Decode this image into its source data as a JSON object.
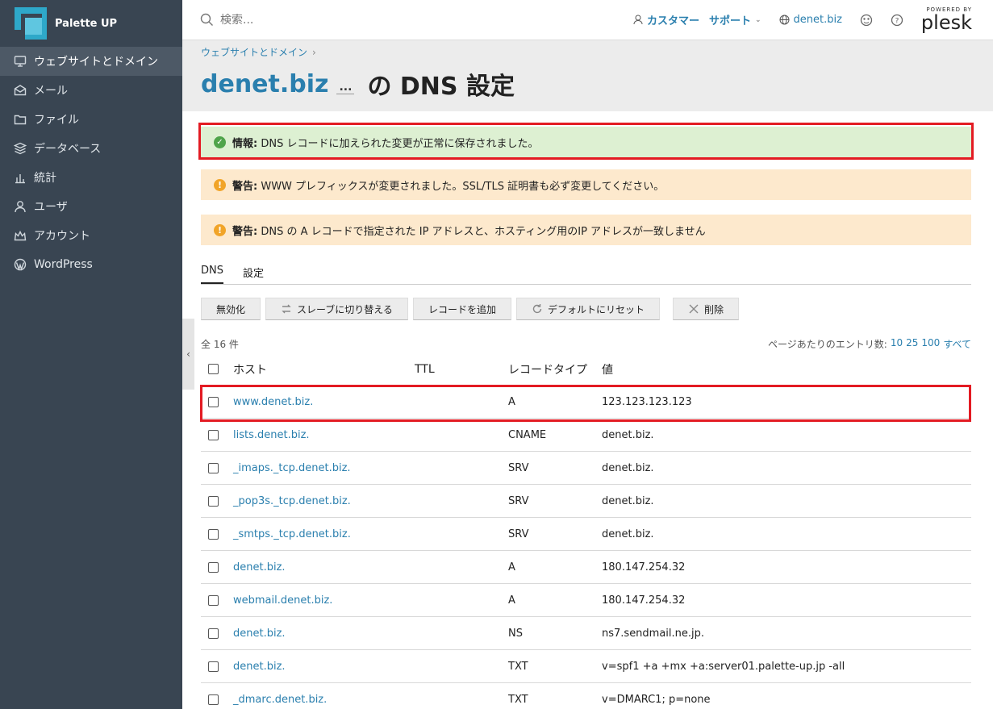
{
  "sidebar": {
    "brand": "Palette UP",
    "items": [
      {
        "label": "ウェブサイトとドメイン",
        "icon": "monitor-icon",
        "active": true
      },
      {
        "label": "メール",
        "icon": "mail-icon"
      },
      {
        "label": "ファイル",
        "icon": "folder-icon"
      },
      {
        "label": "データベース",
        "icon": "database-icon"
      },
      {
        "label": "統計",
        "icon": "bar-chart-icon"
      },
      {
        "label": "ユーザ",
        "icon": "user-icon"
      },
      {
        "label": "アカウント",
        "icon": "crown-icon"
      },
      {
        "label": "WordPress",
        "icon": "wordpress-icon"
      }
    ]
  },
  "header": {
    "search_placeholder": "検索...",
    "customer": "カスタマー",
    "support": "サポート",
    "domain": "denet.biz",
    "powered_by": "POWERED BY",
    "plesk": "plesk"
  },
  "breadcrumb": "ウェブサイトとドメイン",
  "title": {
    "domain": "denet.biz",
    "more": "...",
    "suffix": "の DNS 設定"
  },
  "banners": {
    "info": {
      "label": "情報:",
      "text": " DNS レコードに加えられた変更が正常に保存されました。"
    },
    "warn1": {
      "label": "警告:",
      "text": " WWW プレフィックスが変更されました。SSL/TLS 証明書も必ず変更してください。"
    },
    "warn2": {
      "label": "警告:",
      "text": " DNS の A レコードで指定された IP アドレスと、ホスティング用のIP アドレスが一致しません"
    }
  },
  "tabs": [
    "DNS",
    "設定"
  ],
  "toolbar": {
    "disable": "無効化",
    "slave": "スレーブに切り替える",
    "add": "レコードを追加",
    "reset": "デフォルトにリセット",
    "delete": "削除"
  },
  "total": "全 16 件",
  "perpage": {
    "label": "ページあたりのエントリ数:",
    "options": [
      "10",
      "25",
      "100",
      "すべて"
    ]
  },
  "table": {
    "headers": {
      "host": "ホスト",
      "ttl": "TTL",
      "type": "レコードタイプ",
      "value": "値"
    },
    "rows": [
      {
        "host": "www.denet.biz.",
        "ttl": "",
        "type": "A",
        "value": "123.123.123.123"
      },
      {
        "host": "lists.denet.biz.",
        "ttl": "",
        "type": "CNAME",
        "value": "denet.biz."
      },
      {
        "host": "_imaps._tcp.denet.biz.",
        "ttl": "",
        "type": "SRV",
        "value": "denet.biz."
      },
      {
        "host": "_pop3s._tcp.denet.biz.",
        "ttl": "",
        "type": "SRV",
        "value": "denet.biz."
      },
      {
        "host": "_smtps._tcp.denet.biz.",
        "ttl": "",
        "type": "SRV",
        "value": "denet.biz."
      },
      {
        "host": "denet.biz.",
        "ttl": "",
        "type": "A",
        "value": "180.147.254.32"
      },
      {
        "host": "webmail.denet.biz.",
        "ttl": "",
        "type": "A",
        "value": "180.147.254.32"
      },
      {
        "host": "denet.biz.",
        "ttl": "",
        "type": "NS",
        "value": "ns7.sendmail.ne.jp."
      },
      {
        "host": "denet.biz.",
        "ttl": "",
        "type": "TXT",
        "value": "v=spf1 +a +mx +a:server01.palette-up.jp -all"
      },
      {
        "host": "_dmarc.denet.biz.",
        "ttl": "",
        "type": "TXT",
        "value": "v=DMARC1; p=none"
      }
    ]
  },
  "colors": {
    "sidebar": "#394552",
    "link": "#2a7fae",
    "highlight": "#e31b23"
  }
}
